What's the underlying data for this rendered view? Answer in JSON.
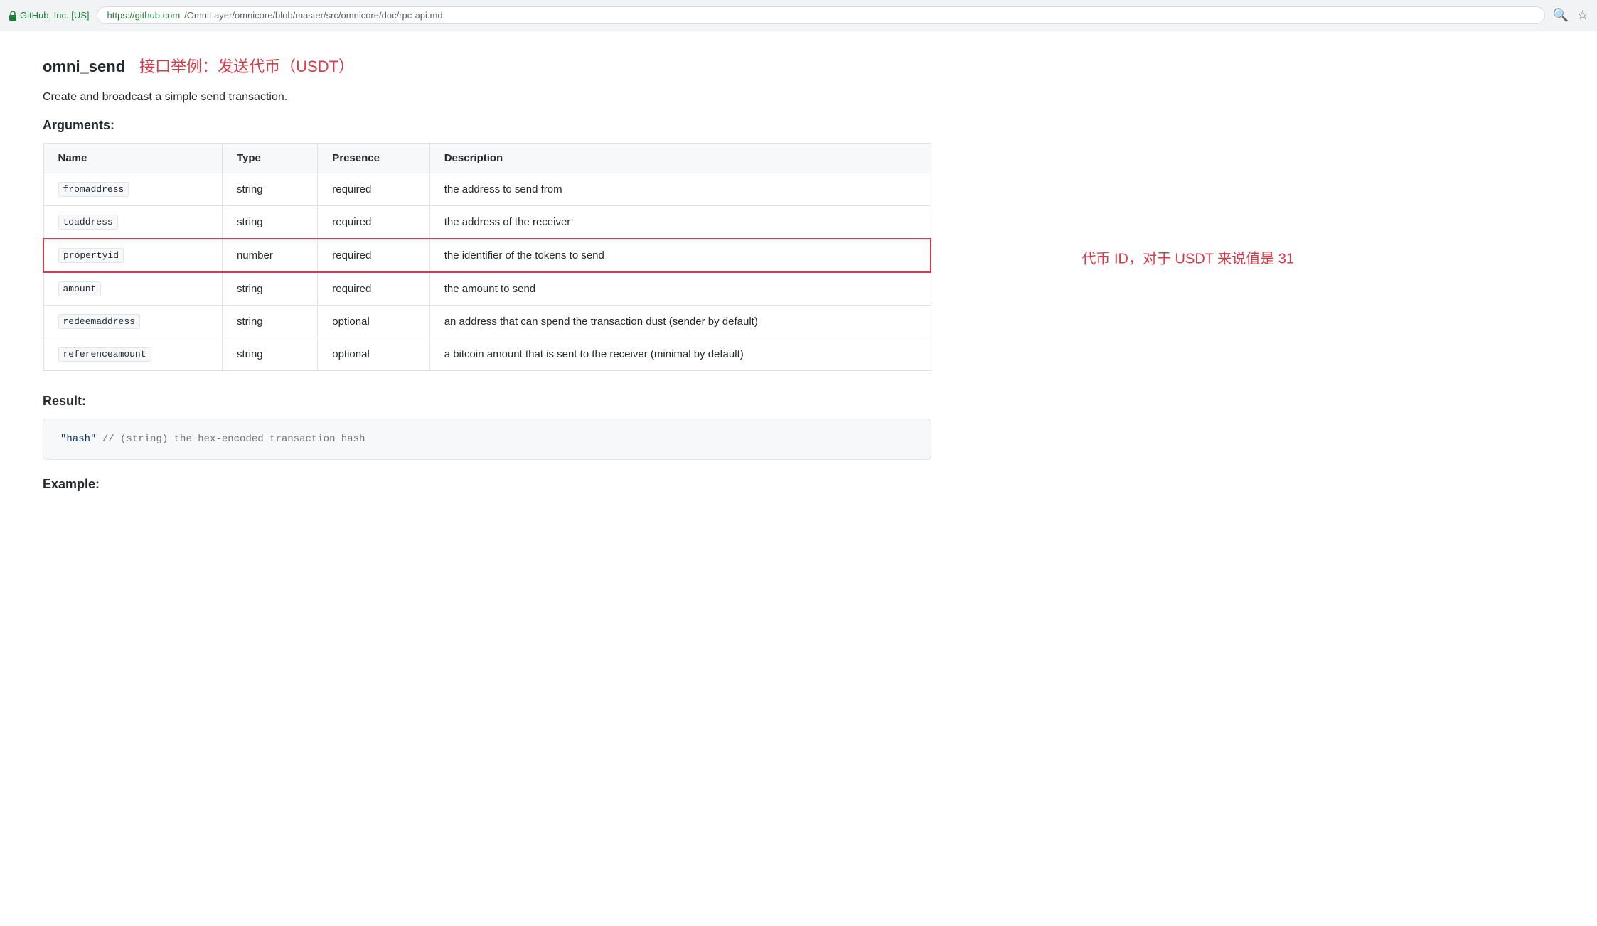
{
  "browser": {
    "company": "GitHub, Inc. [US]",
    "url_green": "https://github.com",
    "url_path": "/OmniLayer/omnicore/blob/master/src/omnicore/doc/rpc-api.md",
    "full_url": "https://github.com/OmniLayer/omnicore/blob/master/src/omnicore/doc/rpc-api.md"
  },
  "page": {
    "title_main": "omni_send",
    "title_sub": "接口举例：发送代币（USDT）",
    "description": "Create and broadcast a simple send transaction.",
    "arguments_heading": "Arguments:",
    "result_heading": "Result:",
    "example_heading": "Example:"
  },
  "table": {
    "headers": [
      "Name",
      "Type",
      "Presence",
      "Description"
    ],
    "rows": [
      {
        "name": "fromaddress",
        "type": "string",
        "presence": "required",
        "description": "the address to send from",
        "highlight": false
      },
      {
        "name": "toaddress",
        "type": "string",
        "presence": "required",
        "description": "the address of the receiver",
        "highlight": false
      },
      {
        "name": "propertyid",
        "type": "number",
        "presence": "required",
        "description": "the identifier of the tokens to send",
        "highlight": true
      },
      {
        "name": "amount",
        "type": "string",
        "presence": "required",
        "description": "the amount to send",
        "highlight": false
      },
      {
        "name": "redeemaddress",
        "type": "string",
        "presence": "optional",
        "description": "an address that can spend the transaction dust (sender by default)",
        "highlight": false
      },
      {
        "name": "referenceamount",
        "type": "string",
        "presence": "optional",
        "description": "a bitcoin amount that is sent to the receiver (minimal by default)",
        "highlight": false
      }
    ],
    "annotation": "代币 ID，对于 USDT 来说值是 31"
  },
  "result": {
    "code": "\"hash\"  // (string) the hex-encoded transaction hash"
  }
}
